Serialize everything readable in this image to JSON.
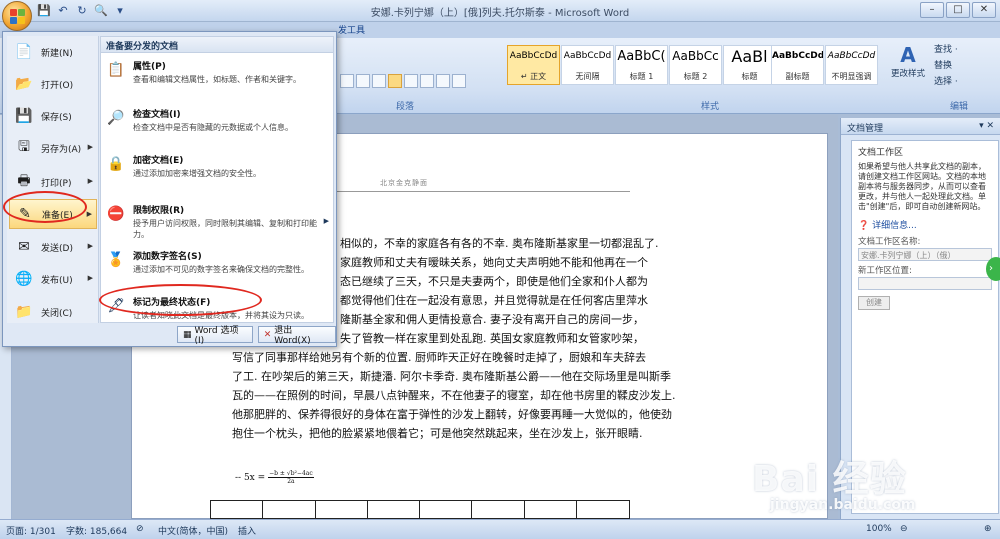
{
  "window": {
    "title": "安娜.卡列宁娜（上）[俄]列夫.托尔斯泰 - Microsoft Word"
  },
  "ribbon": {
    "tab_partial": "发工具",
    "group_paragraph": "段落",
    "group_styles": "样式",
    "group_editing": "编辑",
    "styles": [
      {
        "preview": "AaBbCcDd",
        "label": "↵ 正文",
        "selected": true
      },
      {
        "preview": "AaBbCcDd",
        "label": "无间隔",
        "selected": false
      },
      {
        "preview": "AaBbC(",
        "label": "标题 1",
        "selected": false
      },
      {
        "preview": "AaBbCc",
        "label": "标题 2",
        "selected": false
      },
      {
        "preview": "AaBl",
        "label": "标题",
        "selected": false
      },
      {
        "preview": "AaBbCcDd",
        "label": "副标题",
        "selected": false
      },
      {
        "preview": "AaBbCcDd",
        "label": "不明显强调",
        "selected": false
      }
    ],
    "change_styles": "更改样式",
    "editing": [
      "查找 ·",
      "替换",
      "选择 ·"
    ]
  },
  "office_menu": {
    "left_items": [
      {
        "label": "新建(N)",
        "icon": "new-doc-icon",
        "arrow": false
      },
      {
        "label": "打开(O)",
        "icon": "open-folder-icon",
        "arrow": false
      },
      {
        "label": "保存(S)",
        "icon": "save-disk-icon",
        "arrow": false
      },
      {
        "label": "另存为(A)",
        "icon": "save-as-icon",
        "arrow": true
      },
      {
        "label": "打印(P)",
        "icon": "printer-icon",
        "arrow": true
      },
      {
        "label": "准备(E)",
        "icon": "prepare-icon",
        "arrow": true
      },
      {
        "label": "发送(D)",
        "icon": "send-icon",
        "arrow": true
      },
      {
        "label": "发布(U)",
        "icon": "publish-icon",
        "arrow": true
      },
      {
        "label": "关闭(C)",
        "icon": "close-doc-icon",
        "arrow": false
      }
    ],
    "right_header": "准备要分发的文档",
    "right_items": [
      {
        "title": "属性(P)",
        "desc": "查看和编辑文档属性，如标题、作者和关键字。"
      },
      {
        "title": "检查文档(I)",
        "desc": "检查文档中是否有隐藏的元数据或个人信息。"
      },
      {
        "title": "加密文档(E)",
        "desc": "通过添加加密来增强文档的安全性。"
      },
      {
        "title": "限制权限(R)",
        "desc": "授予用户访问权限，同时限制其编辑、复制和打印能力。"
      },
      {
        "title": "添加数字签名(S)",
        "desc": "通过添加不可见的数字签名来确保文档的完整性。"
      },
      {
        "title": "标记为最终状态(F)",
        "desc": "让读者知晓此文档是最终版本，并将其设为只读。"
      }
    ],
    "word_options": "Word 选项(I)",
    "exit_word": "退出 Word(X)"
  },
  "document": {
    "header": "北京金克静面",
    "lines": [
      "相似的，不幸的家庭各有各的不幸. 奥布隆斯基家里一切都混乱了.",
      "家庭教师和丈夫有暧昧关系，她向丈夫声明她不能和他再在一个",
      "态已继续了三天，不只是夫妻两个，即使是他们全家和仆人都为",
      "都觉得他们住在一起没有意思，并且觉得就是在任何客店里萍水",
      "隆斯基全家和佣人更情投意合. 妻子没有离开自己的房间一步，",
      "失了管教一样在家里到处乱跑. 英国女家庭教师和女管家吵架，",
      "写信了同事那样给她另有个新的位置. 厨师昨天正好在晚餐时走掉了，厨娘和车夫辞去",
      "了工. 在吵架后的第三天，斯捷潘. 阿尔卡季奇. 奥布隆斯基公爵——他在交际场里是叫斯季",
      "瓦的——在照例的时间，早晨八点钟醒来，不在他妻子的寝室，却在他书房里的鞣皮沙发上.",
      "他那肥胖的、保养得很好的身体在富于弹性的沙发上翻转，好像要再睡一大觉似的，他使劲",
      "抱住一个枕头，把他的脸紧紧地偎着它；可是他突然跳起来，坐在沙发上，张开眼睛."
    ],
    "formula_lhs": "-- 5x =",
    "formula_num": "−b ± √b²−4ac",
    "formula_den": "2a"
  },
  "task_pane": {
    "title": "文档管理",
    "section": "文档工作区",
    "description": "如果希望与他人共享此文档的副本，请创建文档工作区网站。文档的本地副本将与服务器同步，从而可以查看更改，并与他人一起处理此文档。单击\"创建\"后，即可自动创建新网站。",
    "more_info": "详细信息...",
    "name_label": "文档工作区名称:",
    "name_value": "安娜.卡列宁娜（上）（俄）",
    "location_label": "新工作区位置:",
    "create_button": "创建"
  },
  "statusbar": {
    "page": "页面: 1/301",
    "words": "字数: 185,664",
    "language": "中文(简体，中国)",
    "mode": "插入",
    "zoom": "100%"
  },
  "watermark": {
    "brand": "Bai 经验",
    "url": "jingyan.baidu.com"
  }
}
